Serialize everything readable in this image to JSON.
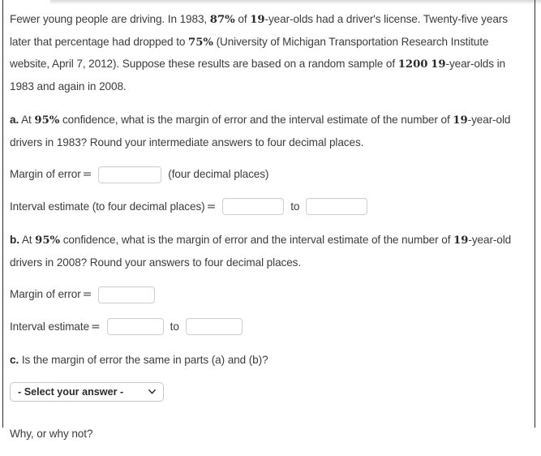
{
  "problem": {
    "intro_parts": [
      {
        "t": "Fewer young people are driving. In 1983, ",
        "m": false
      },
      {
        "t": "87%",
        "m": true
      },
      {
        "t": " of ",
        "m": false
      },
      {
        "t": "19",
        "m": true
      },
      {
        "t": "-year-olds had a driver's license. Twenty-five years later that percentage had dropped to ",
        "m": false
      },
      {
        "t": "75%",
        "m": true
      },
      {
        "t": " (University of Michigan Transportation Research Institute website, April 7, 2012). Suppose these results are based on a random sample of ",
        "m": false
      },
      {
        "t": "1200",
        "m": true
      },
      {
        "t": " ",
        "m": false
      },
      {
        "t": "19",
        "m": true
      },
      {
        "t": "-year-olds in 1983 and again in 2008.",
        "m": false
      }
    ]
  },
  "part_a": {
    "label": "a.",
    "question_parts": [
      {
        "t": " At ",
        "m": false
      },
      {
        "t": "95%",
        "m": true
      },
      {
        "t": " confidence, what is the margin of error and the interval estimate of the number of ",
        "m": false
      },
      {
        "t": "19",
        "m": true
      },
      {
        "t": "-year-old drivers in 1983? Round your intermediate answers to four decimal places.",
        "m": false
      }
    ],
    "margin_label": "Margin of error",
    "margin_equals": "=",
    "margin_value": "",
    "margin_note": "(four decimal places)",
    "interval_label": "Interval estimate (to four decimal places)",
    "interval_equals": "=",
    "interval_low": "",
    "interval_to": "to",
    "interval_high": ""
  },
  "part_b": {
    "label": "b.",
    "question_parts": [
      {
        "t": " At ",
        "m": false
      },
      {
        "t": "95%",
        "m": true
      },
      {
        "t": " confidence, what is the margin of error and the interval estimate of the number of ",
        "m": false
      },
      {
        "t": "19",
        "m": true
      },
      {
        "t": "-year-old drivers in 2008? Round your answers to four decimal places.",
        "m": false
      }
    ],
    "margin_label": "Margin of error",
    "margin_equals": "=",
    "margin_value": "",
    "interval_label": "Interval estimate",
    "interval_equals": "=",
    "interval_low": "",
    "interval_to": "to",
    "interval_high": ""
  },
  "part_c": {
    "label": "c.",
    "question": " Is the margin of error the same in parts (a) and (b)?",
    "select_value": "- Select your answer -",
    "chevron_icon": "chevron-down-icon",
    "followup": "Why, or why not?"
  }
}
